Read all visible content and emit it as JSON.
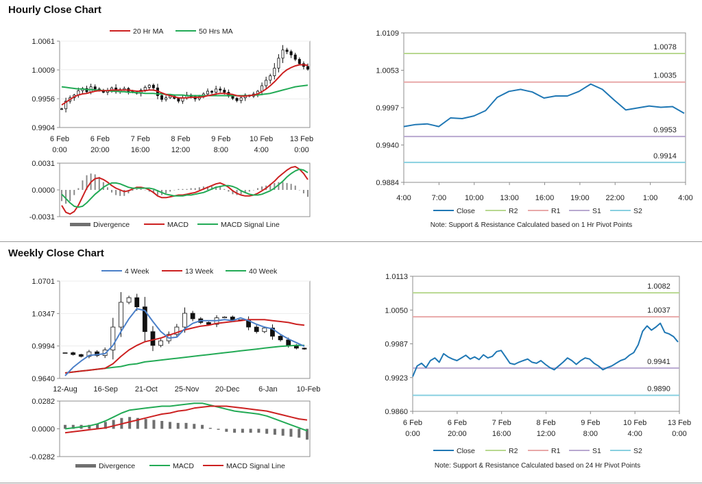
{
  "sections": {
    "hourly_title": "Hourly Close Chart",
    "weekly_title": "Weekly Close Chart"
  },
  "colors": {
    "close": "#1f77b4",
    "ma_red": "#cc2020",
    "ma_green": "#22aa55",
    "ma_blue": "#4a7fc8",
    "r2": "#b8d890",
    "r1": "#e8a8a8",
    "s1": "#b8a8d0",
    "s2": "#88d0e0",
    "bar": "#707070"
  },
  "chart_data": [
    {
      "id": "hourly_price",
      "type": "candlestick",
      "y_ticks": [
        "1.0061",
        "1.0009",
        "0.9956",
        "0.9904"
      ],
      "ylim": [
        0.9904,
        1.0061
      ],
      "x_tick_labels": [
        [
          "6 Feb",
          "0:00"
        ],
        [
          "6 Feb",
          "20:00"
        ],
        [
          "7 Feb",
          "16:00"
        ],
        [
          "8 Feb",
          "12:00"
        ],
        [
          "9 Feb",
          "8:00"
        ],
        [
          "10 Feb",
          "4:00"
        ],
        [
          "13 Feb",
          "0:00"
        ]
      ],
      "legend": [
        "20 Hr MA",
        "50 Hrs MA"
      ],
      "close": [
        0.9938,
        0.9952,
        0.9958,
        0.9963,
        0.9971,
        0.9975,
        0.9969,
        0.9978,
        0.9974,
        0.9972,
        0.9968,
        0.9971,
        0.9976,
        0.9969,
        0.9973,
        0.9975,
        0.997,
        0.9968,
        0.9966,
        0.9972,
        0.9977,
        0.9981,
        0.9976,
        0.9962,
        0.9955,
        0.9958,
        0.9961,
        0.9957,
        0.9952,
        0.9958,
        0.9963,
        0.996,
        0.9956,
        0.996,
        0.9965,
        0.997,
        0.9968,
        0.9974,
        0.9972,
        0.9968,
        0.9961,
        0.9957,
        0.9953,
        0.9958,
        0.9963,
        0.9961,
        0.9965,
        0.997,
        0.998,
        0.999,
        0.9998,
        1.0012,
        1.003,
        1.0045,
        1.0042,
        1.0036,
        1.0028,
        1.002,
        1.0015,
        1.001
      ],
      "ma20": [
        0.9945,
        0.995,
        0.9955,
        0.996,
        0.9963,
        0.9965,
        0.9966,
        0.9968,
        0.997,
        0.9971,
        0.9971,
        0.9971,
        0.9972,
        0.9972,
        0.9972,
        0.9972,
        0.9972,
        0.9971,
        0.997,
        0.997,
        0.9971,
        0.9972,
        0.9972,
        0.997,
        0.9967,
        0.9964,
        0.9962,
        0.996,
        0.9958,
        0.9958,
        0.9958,
        0.9959,
        0.9959,
        0.9959,
        0.996,
        0.9962,
        0.9963,
        0.9965,
        0.9966,
        0.9966,
        0.9965,
        0.9964,
        0.9962,
        0.9961,
        0.9961,
        0.9962,
        0.9963,
        0.9965,
        0.9969,
        0.9974,
        0.998,
        0.9987,
        0.9995,
        1.0003,
        1.0009,
        1.0013,
        1.0016,
        1.0018,
        1.0018,
        1.0017
      ],
      "ma50": [
        0.9978,
        0.9977,
        0.9976,
        0.9975,
        0.9974,
        0.9974,
        0.9973,
        0.9973,
        0.9972,
        0.9972,
        0.9971,
        0.9971,
        0.997,
        0.997,
        0.9969,
        0.9969,
        0.9968,
        0.9968,
        0.9967,
        0.9967,
        0.9966,
        0.9966,
        0.9966,
        0.9965,
        0.9965,
        0.9964,
        0.9964,
        0.9963,
        0.9963,
        0.9963,
        0.9962,
        0.9962,
        0.9962,
        0.9962,
        0.9962,
        0.9962,
        0.9962,
        0.9962,
        0.9962,
        0.9962,
        0.9962,
        0.9962,
        0.9962,
        0.9962,
        0.9962,
        0.9962,
        0.9963,
        0.9963,
        0.9964,
        0.9965,
        0.9966,
        0.9968,
        0.997,
        0.9972,
        0.9974,
        0.9976,
        0.9978,
        0.9979,
        0.998,
        0.9981
      ]
    },
    {
      "id": "hourly_macd",
      "type": "bar_line",
      "y_ticks": [
        "0.0031",
        "0.0000",
        "-0.0031"
      ],
      "ylim": [
        -0.0031,
        0.0031
      ],
      "legend": [
        "Divergence",
        "MACD",
        "MACD Signal Line"
      ],
      "macd": [
        -0.0018,
        -0.0026,
        -0.0028,
        -0.0025,
        -0.0018,
        -0.0008,
        0.0002,
        0.0009,
        0.0013,
        0.0014,
        0.0012,
        0.0009,
        0.0005,
        0.0002,
        0.0,
        -0.0002,
        -0.0001,
        0.0001,
        0.0003,
        0.0003,
        0.0002,
        0.0,
        -0.0003,
        -0.0007,
        -0.0009,
        -0.0009,
        -0.0008,
        -0.0007,
        -0.0006,
        -0.0006,
        -0.0005,
        -0.0004,
        -0.0003,
        -0.0001,
        0.0001,
        0.0003,
        0.0005,
        0.0007,
        0.0008,
        0.0006,
        0.0003,
        -0.0001,
        -0.0004,
        -0.0006,
        -0.0007,
        -0.0007,
        -0.0006,
        -0.0004,
        -0.0001,
        0.0002,
        0.0006,
        0.001,
        0.0015,
        0.0019,
        0.0023,
        0.0026,
        0.0027,
        0.0024,
        0.0019,
        0.0012
      ],
      "signal": [
        -0.0005,
        -0.001,
        -0.0015,
        -0.0019,
        -0.002,
        -0.0019,
        -0.0015,
        -0.001,
        -0.0005,
        -0.0001,
        0.0003,
        0.0006,
        0.0008,
        0.0008,
        0.0007,
        0.0005,
        0.0003,
        0.0002,
        0.0002,
        0.0002,
        0.0002,
        0.0002,
        0.0001,
        -0.0001,
        -0.0003,
        -0.0005,
        -0.0006,
        -0.0007,
        -0.0007,
        -0.0007,
        -0.0006,
        -0.0006,
        -0.0005,
        -0.0004,
        -0.0003,
        -0.0001,
        0.0001,
        0.0003,
        0.0004,
        0.0005,
        0.0005,
        0.0004,
        0.0002,
        -0.0001,
        -0.0003,
        -0.0005,
        -0.0006,
        -0.0006,
        -0.0005,
        -0.0003,
        -0.0001,
        0.0002,
        0.0006,
        0.001,
        0.0015,
        0.0019,
        0.0022,
        0.0024,
        0.0023,
        0.002
      ],
      "divergence": [
        -0.0013,
        -0.0016,
        -0.0013,
        -0.0006,
        0.0002,
        0.0011,
        0.0017,
        0.0019,
        0.0018,
        0.0015,
        0.0009,
        0.0003,
        -0.0003,
        -0.0006,
        -0.0007,
        -0.0007,
        -0.0004,
        -0.0001,
        0.0001,
        0.0001,
        0.0,
        -0.0002,
        -0.0004,
        -0.0006,
        -0.0006,
        -0.0004,
        -0.0002,
        0.0,
        0.0001,
        0.0001,
        0.0001,
        0.0002,
        0.0002,
        0.0003,
        0.0004,
        0.0004,
        0.0004,
        0.0004,
        0.0004,
        0.0001,
        -0.0002,
        -0.0005,
        -0.0006,
        -0.0005,
        -0.0004,
        -0.0002,
        0.0,
        0.0002,
        0.0004,
        0.0005,
        0.0007,
        0.0008,
        0.0009,
        0.0009,
        0.0008,
        0.0007,
        0.0005,
        0.0,
        -0.0004,
        -0.0008
      ]
    },
    {
      "id": "hourly_pivot",
      "type": "line",
      "y_ticks": [
        "1.0109",
        "1.0053",
        "0.9997",
        "0.9940",
        "0.9884"
      ],
      "ylim": [
        0.9884,
        1.0109
      ],
      "x_tick_labels": [
        "4:00",
        "7:00",
        "10:00",
        "13:00",
        "16:00",
        "19:00",
        "22:00",
        "1:00",
        "4:00"
      ],
      "legend": [
        "Close",
        "R2",
        "R1",
        "S1",
        "S2"
      ],
      "levels": {
        "R2": 1.0078,
        "R1": 1.0035,
        "S1": 0.9953,
        "S2": 0.9914
      },
      "level_labels": {
        "R2": "1.0078",
        "R1": "1.0035",
        "S1": "0.9953",
        "S2": "0.9914"
      },
      "note": "Note: Support & Resistance Calculated based on 1 Hr Pivot Points",
      "close": [
        0.9968,
        0.9971,
        0.9972,
        0.9968,
        0.9981,
        0.998,
        0.9984,
        0.9992,
        1.0012,
        1.0021,
        1.0024,
        1.002,
        1.0011,
        1.0014,
        1.0014,
        1.0021,
        1.0032,
        1.0024,
        1.0008,
        0.9993,
        0.9996,
        0.9999,
        0.9997,
        0.9998,
        0.9988
      ]
    },
    {
      "id": "weekly_price",
      "type": "candlestick",
      "y_ticks": [
        "1.0701",
        "1.0347",
        "0.9994",
        "0.9640"
      ],
      "ylim": [
        0.964,
        1.0701
      ],
      "x_tick_labels": [
        "12-Aug",
        "16-Sep",
        "21-Oct",
        "25-Nov",
        "20-Dec",
        "6-Jan",
        "10-Feb"
      ],
      "legend": [
        "4 Week",
        "13 Week",
        "40 Week"
      ],
      "close": [
        0.992,
        0.99,
        0.988,
        0.993,
        0.989,
        0.995,
        1.02,
        1.047,
        1.052,
        1.042,
        1.015,
        1.0,
        1.005,
        1.012,
        1.02,
        1.035,
        1.029,
        1.025,
        1.023,
        1.03,
        1.031,
        1.028,
        1.028,
        1.02,
        1.015,
        1.019,
        1.01,
        1.006,
        1.0,
        0.997,
        0.996
      ],
      "ma4": [
        0.967,
        0.976,
        0.983,
        0.989,
        0.99,
        0.991,
        1.0,
        1.015,
        1.029,
        1.04,
        1.038,
        1.026,
        1.015,
        1.008,
        1.009,
        1.018,
        1.024,
        1.027,
        1.027,
        1.027,
        1.028,
        1.027,
        1.03,
        1.027,
        1.023,
        1.02,
        1.018,
        1.012,
        1.007,
        1.003,
        0.999
      ],
      "ma13": [
        0.97,
        0.971,
        0.972,
        0.973,
        0.974,
        0.975,
        0.98,
        0.988,
        0.995,
        1.0,
        1.004,
        1.006,
        1.008,
        1.011,
        1.014,
        1.017,
        1.019,
        1.021,
        1.022,
        1.024,
        1.025,
        1.026,
        1.027,
        1.028,
        1.028,
        1.028,
        1.027,
        1.026,
        1.025,
        1.023,
        1.022
      ],
      "ma40": [
        0.97,
        0.971,
        0.972,
        0.973,
        0.974,
        0.975,
        0.976,
        0.977,
        0.979,
        0.98,
        0.982,
        0.983,
        0.984,
        0.985,
        0.986,
        0.987,
        0.988,
        0.989,
        0.99,
        0.991,
        0.992,
        0.993,
        0.994,
        0.995,
        0.996,
        0.997,
        0.998,
        0.999,
        0.9995,
        1.0,
        1.0
      ]
    },
    {
      "id": "weekly_macd",
      "type": "bar_line",
      "y_ticks": [
        "0.0282",
        "0.0000",
        "-0.0282"
      ],
      "ylim": [
        -0.0282,
        0.0282
      ],
      "legend": [
        "Divergence",
        "MACD",
        "MACD Signal Line"
      ],
      "macd": [
        0.0,
        0.001,
        0.002,
        0.003,
        0.005,
        0.008,
        0.012,
        0.016,
        0.019,
        0.02,
        0.021,
        0.022,
        0.023,
        0.023,
        0.024,
        0.025,
        0.026,
        0.026,
        0.024,
        0.022,
        0.02,
        0.018,
        0.017,
        0.016,
        0.015,
        0.013,
        0.01,
        0.007,
        0.004,
        0.001,
        -0.002
      ],
      "signal": [
        -0.004,
        -0.003,
        -0.002,
        -0.001,
        0.0,
        0.001,
        0.003,
        0.005,
        0.007,
        0.009,
        0.011,
        0.013,
        0.015,
        0.016,
        0.018,
        0.019,
        0.021,
        0.022,
        0.023,
        0.023,
        0.023,
        0.022,
        0.021,
        0.02,
        0.019,
        0.018,
        0.016,
        0.014,
        0.012,
        0.01,
        0.009
      ],
      "divergence": [
        0.004,
        0.004,
        0.004,
        0.004,
        0.005,
        0.007,
        0.009,
        0.011,
        0.012,
        0.011,
        0.01,
        0.009,
        0.008,
        0.007,
        0.006,
        0.006,
        0.005,
        0.004,
        0.001,
        -0.001,
        -0.003,
        -0.004,
        -0.004,
        -0.004,
        -0.004,
        -0.005,
        -0.006,
        -0.007,
        -0.008,
        -0.009,
        -0.011
      ]
    },
    {
      "id": "weekly_pivot",
      "type": "line",
      "y_ticks": [
        "1.0113",
        "1.0050",
        "0.9987",
        "0.9923",
        "0.9860"
      ],
      "ylim": [
        0.986,
        1.0113
      ],
      "x_tick_labels": [
        [
          "6 Feb",
          "0:00"
        ],
        [
          "6 Feb",
          "20:00"
        ],
        [
          "7 Feb",
          "16:00"
        ],
        [
          "8 Feb",
          "12:00"
        ],
        [
          "9 Feb",
          "8:00"
        ],
        [
          "10 Feb",
          "4:00"
        ],
        [
          "13 Feb",
          "0:00"
        ]
      ],
      "legend": [
        "Close",
        "R2",
        "R1",
        "S1",
        "S2"
      ],
      "levels": {
        "R2": 1.0082,
        "R1": 1.0037,
        "S1": 0.9941,
        "S2": 0.989
      },
      "level_labels": {
        "R2": "1.0082",
        "R1": "1.0037",
        "S1": "0.9941",
        "S2": "0.9890"
      },
      "note": "Note: Support & Resistance Calculated based on 24 Hr Pivot Points",
      "close": [
        0.9925,
        0.9945,
        0.995,
        0.9942,
        0.9955,
        0.996,
        0.9952,
        0.9968,
        0.9962,
        0.9958,
        0.9955,
        0.996,
        0.9965,
        0.9958,
        0.9962,
        0.9957,
        0.9966,
        0.996,
        0.9963,
        0.9972,
        0.9974,
        0.9962,
        0.995,
        0.9948,
        0.9952,
        0.9955,
        0.9958,
        0.9952,
        0.995,
        0.9955,
        0.9948,
        0.9942,
        0.9938,
        0.9945,
        0.9952,
        0.996,
        0.9955,
        0.9948,
        0.9955,
        0.996,
        0.9958,
        0.995,
        0.9945,
        0.9938,
        0.9942,
        0.9945,
        0.995,
        0.9955,
        0.9958,
        0.9965,
        0.997,
        0.9985,
        1.001,
        1.002,
        1.0012,
        1.0018,
        1.0025,
        1.0008,
        1.0005,
        1.0,
        0.999
      ]
    }
  ]
}
